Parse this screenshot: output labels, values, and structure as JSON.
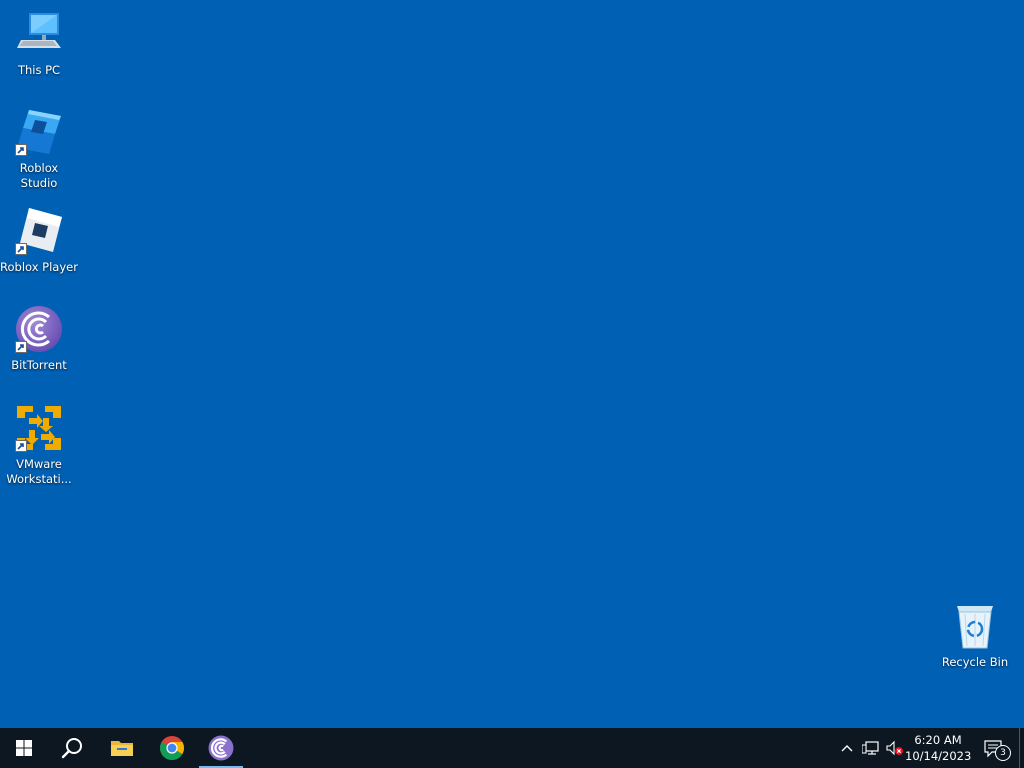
{
  "desktop": {
    "background_color": "#0060b4",
    "icons": [
      {
        "label": "This PC",
        "icon": "computer-icon"
      },
      {
        "label": "Roblox Studio",
        "icon": "roblox-studio-icon"
      },
      {
        "label": "Roblox Player",
        "icon": "roblox-player-icon"
      },
      {
        "label": "BitTorrent",
        "icon": "bittorrent-icon"
      },
      {
        "label": "VMware\nWorkstati...",
        "icon": "vmware-icon"
      },
      {
        "label": "Recycle Bin",
        "icon": "recycle-bin-icon"
      }
    ]
  },
  "taskbar": {
    "items": [
      {
        "name": "Start",
        "icon": "windows-logo-icon"
      },
      {
        "name": "Search",
        "icon": "search-icon"
      },
      {
        "name": "File Explorer",
        "icon": "folder-icon"
      },
      {
        "name": "Google Chrome",
        "icon": "chrome-icon"
      },
      {
        "name": "BitTorrent",
        "icon": "bittorrent-icon",
        "active": true
      }
    ],
    "tray": {
      "icons": [
        "chevron-up-icon",
        "network-icon",
        "volume-muted-icon"
      ],
      "time": "6:20 AM",
      "date": "10/14/2023",
      "notification_count": "3"
    }
  }
}
